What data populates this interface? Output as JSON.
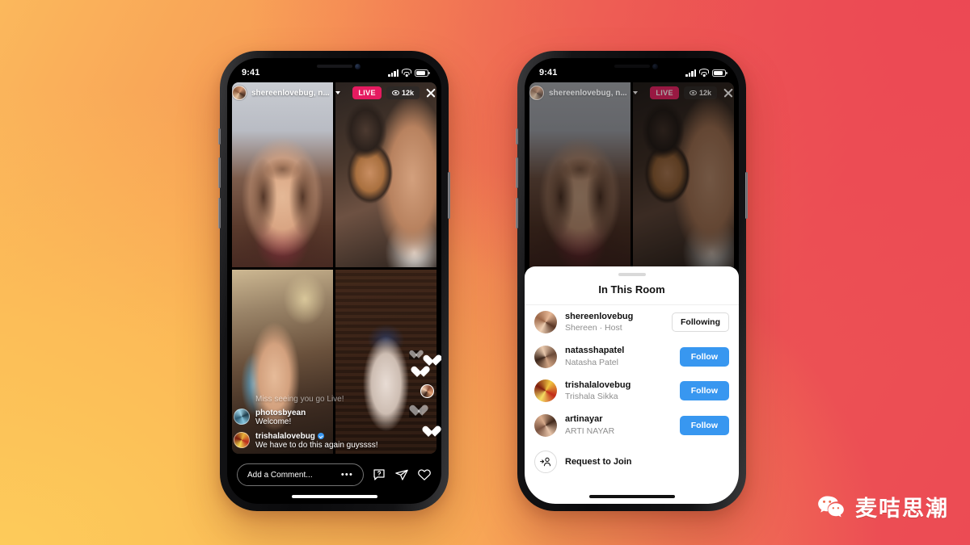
{
  "watermark": {
    "text": "麦咭思潮",
    "logo_icon": "wechat-logo-icon"
  },
  "phone_left": {
    "status_bar": {
      "time": "9:41",
      "signal_icon": "cellular-bars-icon",
      "wifi_icon": "wifi-icon",
      "battery_icon": "battery-icon"
    },
    "top_bar": {
      "host_avatar_icon": "host-avatar",
      "host_label": "shereenlovebug, n...",
      "chevron_icon": "chevron-down-icon",
      "live_badge": "LIVE",
      "viewer_icon": "eye-icon",
      "viewer_count": "12k",
      "close_icon": "close-icon"
    },
    "tiles": [
      {
        "name": "tile-shereen"
      },
      {
        "name": "tile-natassha"
      },
      {
        "name": "tile-trishala"
      },
      {
        "name": "tile-arti"
      }
    ],
    "comments": [
      {
        "user": "",
        "text": "Miss seeing you go Live!",
        "verified": false,
        "faded": true
      },
      {
        "user": "photosbyean",
        "text": "Welcome!",
        "verified": false,
        "faded": false
      },
      {
        "user": "trishalalovebug",
        "text": "We have to do this again guyssss!",
        "verified": true,
        "faded": false
      }
    ],
    "bottom_bar": {
      "comment_placeholder": "Add a Comment...",
      "more_icon": "ellipsis-icon",
      "question_icon": "question-bubble-icon",
      "share_icon": "paper-plane-icon",
      "like_icon": "heart-icon"
    }
  },
  "phone_right": {
    "status_bar": {
      "time": "9:41",
      "signal_icon": "cellular-bars-icon",
      "wifi_icon": "wifi-icon",
      "battery_icon": "battery-icon"
    },
    "top_bar": {
      "host_label": "shereenlovebug, n...",
      "chevron_icon": "chevron-down-icon",
      "live_badge": "LIVE",
      "viewer_icon": "eye-icon",
      "viewer_count": "12k",
      "close_icon": "close-icon"
    },
    "sheet": {
      "grabber_icon": "drag-handle",
      "title": "In This Room",
      "participants": [
        {
          "username": "shereenlovebug",
          "fullname": "Shereen · Host",
          "action": "Following",
          "action_style": "outline",
          "avatar": "ra-shereen"
        },
        {
          "username": "natasshapatel",
          "fullname": "Natasha Patel",
          "action": "Follow",
          "action_style": "filled",
          "avatar": "ra-natassha"
        },
        {
          "username": "trishalalovebug",
          "fullname": "Trishala Sikka",
          "action": "Follow",
          "action_style": "filled",
          "avatar": "ra-trishala"
        },
        {
          "username": "artinayar",
          "fullname": "ARTI NAYAR",
          "action": "Follow",
          "action_style": "filled",
          "avatar": "ra-arti"
        }
      ],
      "request_row": {
        "icon": "person-add-icon",
        "label": "Request to Join"
      }
    }
  },
  "colors": {
    "live_pink": "#E51B60",
    "instagram_blue": "#3897F0",
    "bg_gradient_from": "#FBB85C",
    "bg_gradient_to": "#EC4B54",
    "sheet_bg": "#FFFFFF"
  }
}
